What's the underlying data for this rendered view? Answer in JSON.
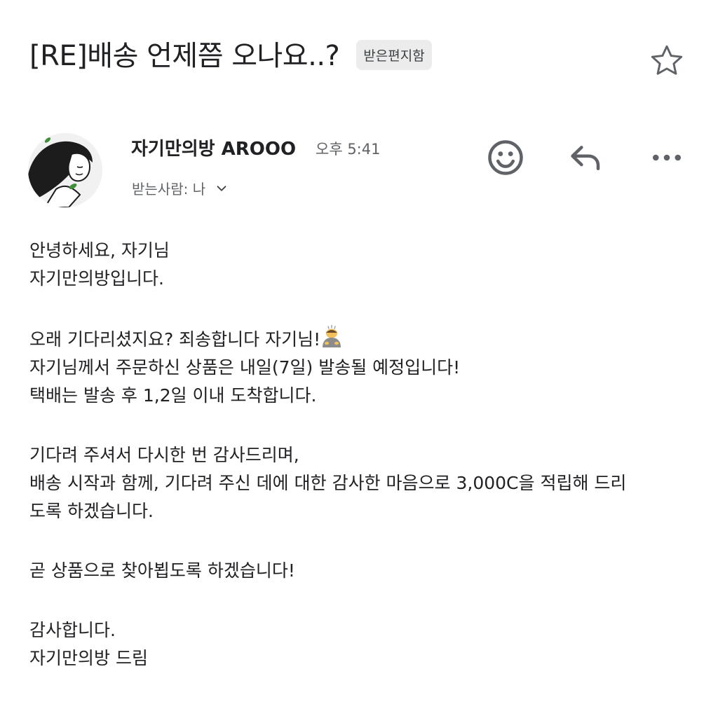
{
  "email": {
    "subject": "[RE]배송 언제쯤 오나요..?",
    "label": "받은편지함",
    "sender_name": "자기만의방 AROOO",
    "time": "오후 5:41",
    "recipient_label": "받는사람: 나"
  },
  "icons": {
    "star": "star-outline-icon",
    "emoji": "emoji-smile-icon",
    "reply": "reply-arrow-icon",
    "more": "more-horizontal-icon",
    "chevron": "chevron-down-icon"
  },
  "body": {
    "p1": [
      "안녕하세요, 자기님",
      "자기만의방입니다."
    ],
    "p2": [
      "오래 기다리셨지요? 죄송합니다 자기님!",
      "자기님께서 주문하신 상품은 내일(7일) 발송될 예정입니다!",
      "택배는 발송 후 1,2일 이내 도착합니다."
    ],
    "p3": [
      "기다려 주셔서 다시한 번 감사드리며,",
      "배송 시작과 함께, 기다려 주신 데에 대한 감사한 마음으로 3,000C을 적립해 드리",
      "도록 하겠습니다."
    ],
    "p4": [
      "곧 상품으로 찾아뵙도록 하겠습니다!"
    ],
    "p5": [
      "감사합니다.",
      "자기만의방 드림"
    ]
  },
  "colors": {
    "text": "#202124",
    "secondary": "#5f6368",
    "chip_bg": "#ececec",
    "icon": "#5f6368"
  }
}
